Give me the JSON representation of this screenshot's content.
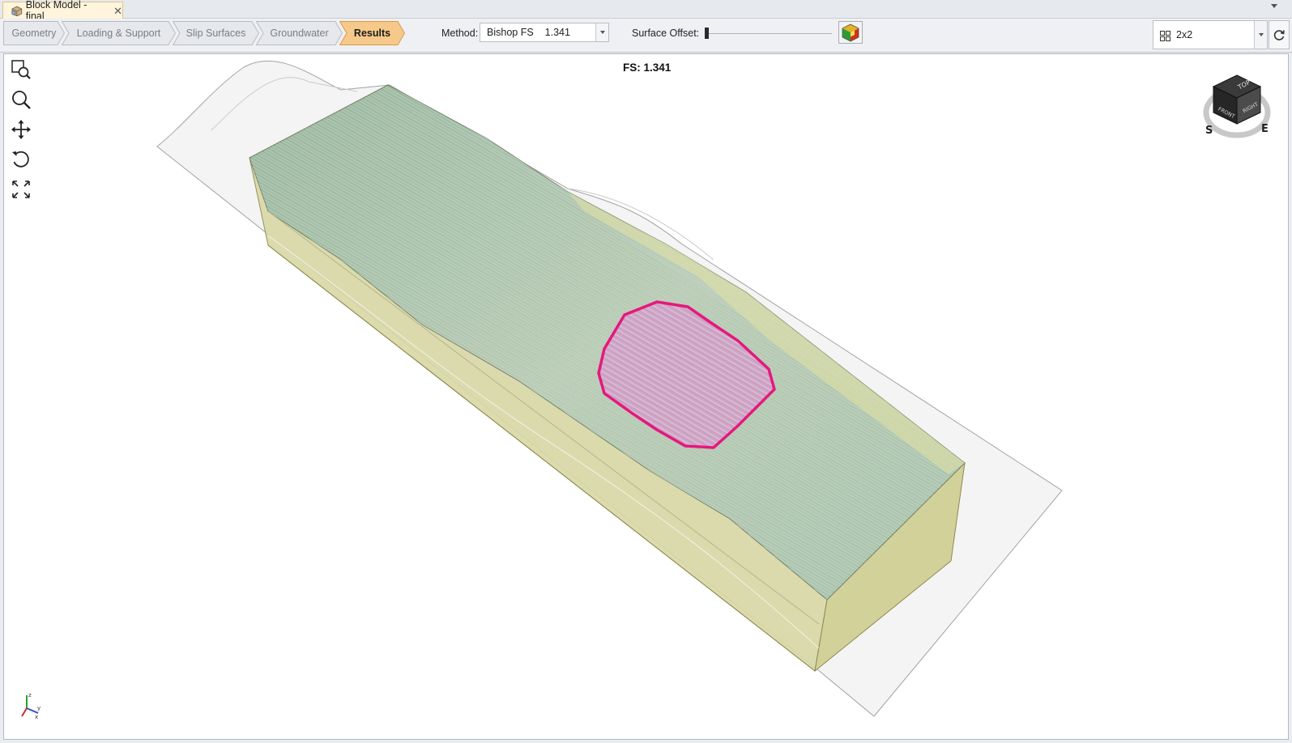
{
  "document_tab": {
    "title": "Block Model - final",
    "close_glyph": "✕",
    "icon": "block-model-icon"
  },
  "workflow_steps": [
    {
      "label": "Geometry",
      "active": false
    },
    {
      "label": "Loading & Support",
      "active": false
    },
    {
      "label": "Slip Surfaces",
      "active": false
    },
    {
      "label": "Groundwater",
      "active": false
    },
    {
      "label": "Results",
      "active": true
    }
  ],
  "method": {
    "label": "Method:",
    "selected_name": "Bishop FS",
    "selected_value": "1.341"
  },
  "surface_offset": {
    "label": "Surface Offset:",
    "value": 0
  },
  "layout": {
    "value": "2x2",
    "icon": "grid-2x2-icon"
  },
  "viewport": {
    "fs_label": "FS: 1.341",
    "tools": [
      "zoom-window-icon",
      "zoom-icon",
      "pan-icon",
      "rotate-icon",
      "zoom-extents-icon"
    ],
    "view_cube": {
      "top": "TOP",
      "front": "FRONT",
      "right": "RIGHT",
      "compass_south": "S",
      "compass_east": "E"
    },
    "axis_triad": {
      "x": "x",
      "y": "y",
      "z": "z"
    }
  },
  "colors": {
    "active_step": "#f6c98a",
    "slip_surface": "#e5187e",
    "block_side": "#d8d7a2",
    "block_top": "#a9c9a8",
    "terrain_shell": "#f2f2f2"
  }
}
